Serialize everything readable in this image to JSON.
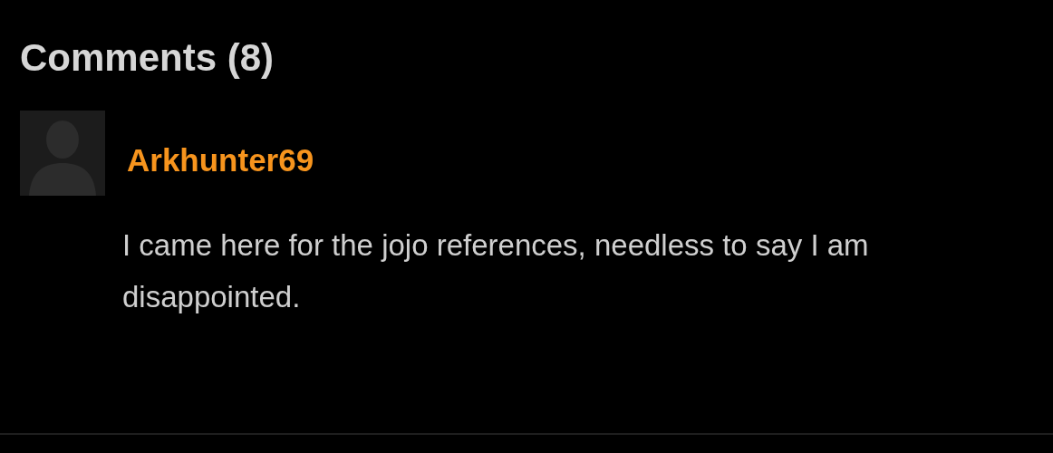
{
  "heading": "Comments (8)",
  "comments": [
    {
      "author": "Arkhunter69",
      "text": "I came here for the jojo references, needless to say I am disappointed."
    }
  ]
}
